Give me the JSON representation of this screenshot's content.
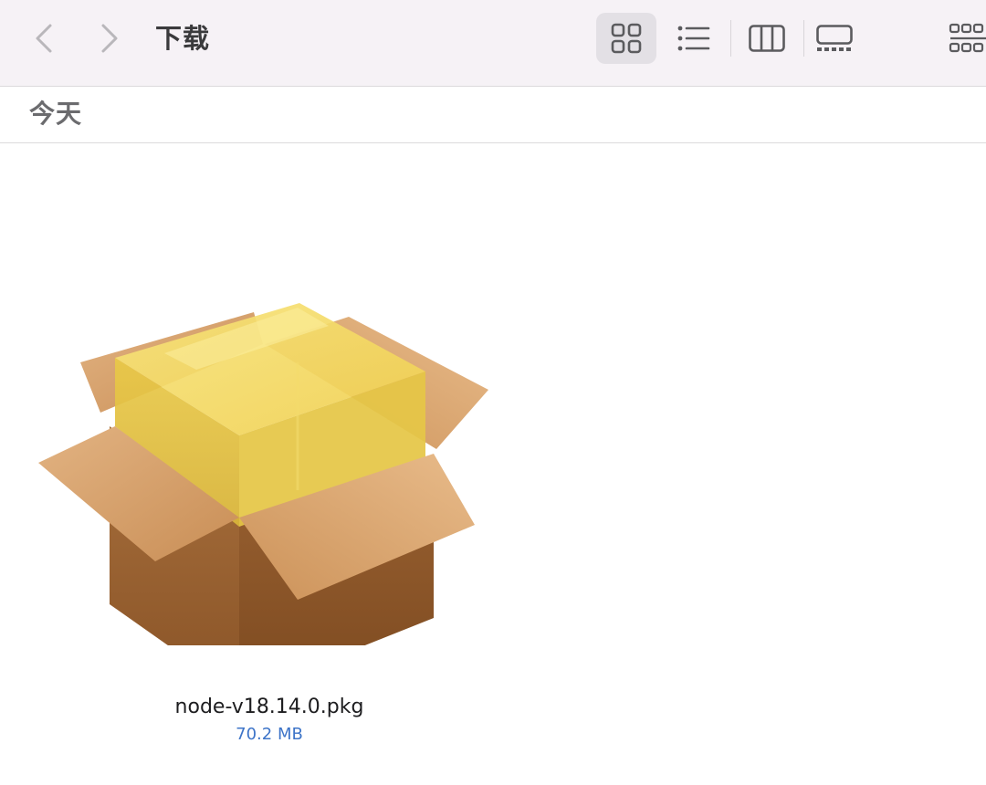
{
  "window": {
    "title": "下载"
  },
  "toolbar": {
    "back_icon": "chevron-left",
    "forward_icon": "chevron-right",
    "views": [
      {
        "name": "icon-view",
        "icon": "grid-2x2",
        "active": true
      },
      {
        "name": "list-view",
        "icon": "list-bullets",
        "active": false
      },
      {
        "name": "column-view",
        "icon": "columns",
        "active": false
      },
      {
        "name": "gallery-view",
        "icon": "gallery",
        "active": false
      },
      {
        "name": "group-view",
        "icon": "grid-more",
        "active": false
      }
    ]
  },
  "section": {
    "title": "今天"
  },
  "files": [
    {
      "name": "node-v18.14.0.pkg",
      "size": "70.2 MB",
      "icon": "package-box"
    }
  ],
  "colors": {
    "toolbar_bg": "#f6f2f6",
    "active_view_bg": "#e3e0e5",
    "size_text": "#3d74c8",
    "title_text": "#3a3a3c"
  }
}
